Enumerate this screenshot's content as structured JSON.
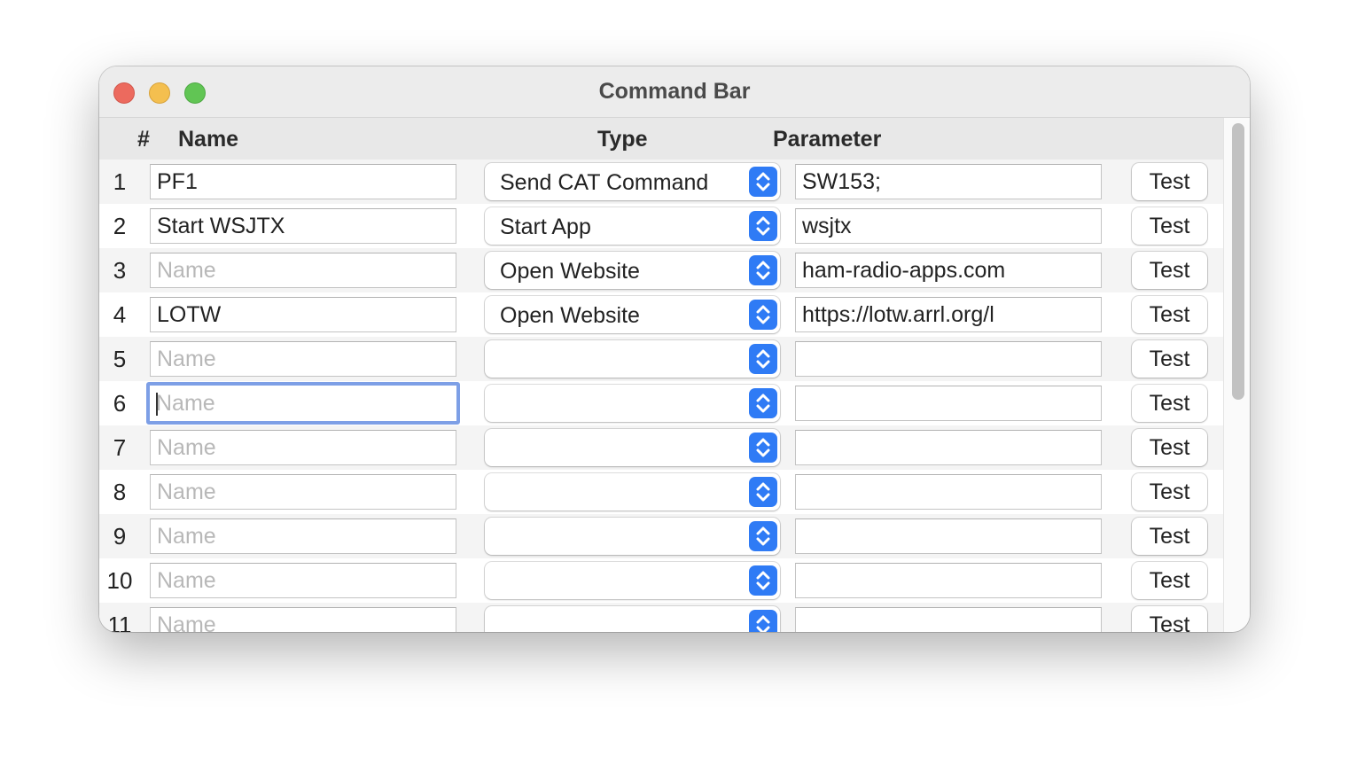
{
  "window": {
    "title": "Command Bar"
  },
  "columns": {
    "number": "#",
    "name": "Name",
    "type": "Type",
    "parameter": "Parameter"
  },
  "placeholders": {
    "name": "Name"
  },
  "test_label": "Test",
  "rows": [
    {
      "num": "1",
      "name": "PF1",
      "type": "Send CAT Command",
      "param": "SW153;"
    },
    {
      "num": "2",
      "name": "Start WSJTX",
      "type": "Start App",
      "param": "wsjtx"
    },
    {
      "num": "3",
      "name": "",
      "type": "Open Website",
      "param": "ham-radio-apps.com"
    },
    {
      "num": "4",
      "name": "LOTW",
      "type": "Open Website",
      "param": "https://lotw.arrl.org/l"
    },
    {
      "num": "5",
      "name": "",
      "type": "",
      "param": ""
    },
    {
      "num": "6",
      "name": "",
      "type": "",
      "param": ""
    },
    {
      "num": "7",
      "name": "",
      "type": "",
      "param": ""
    },
    {
      "num": "8",
      "name": "",
      "type": "",
      "param": ""
    },
    {
      "num": "9",
      "name": "",
      "type": "",
      "param": ""
    },
    {
      "num": "10",
      "name": "",
      "type": "",
      "param": ""
    },
    {
      "num": "11",
      "name": "",
      "type": "",
      "param": ""
    }
  ],
  "focused_row": "6",
  "colors": {
    "accent": "#2f7bf5",
    "focus_ring": "#7d9fe6"
  }
}
